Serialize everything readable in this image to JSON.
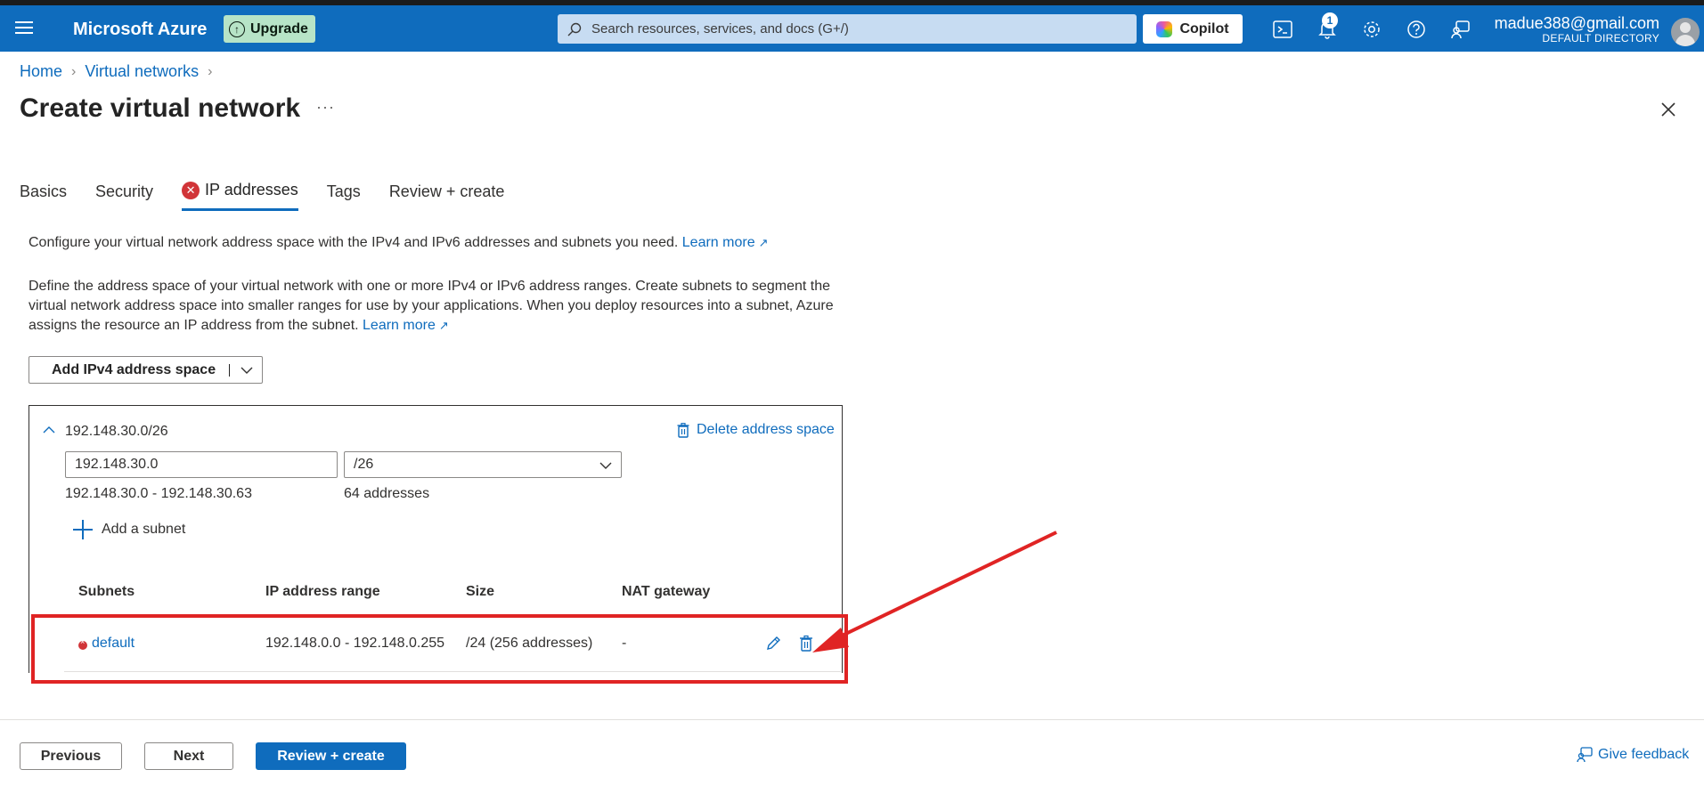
{
  "topbar": {
    "brand": "Microsoft Azure",
    "upgrade_label": "Upgrade",
    "search_placeholder": "Search resources, services, and docs (G+/)",
    "copilot_label": "Copilot",
    "notification_count": "1",
    "user_email": "madue388@gmail.com",
    "user_directory": "DEFAULT DIRECTORY"
  },
  "breadcrumb": {
    "items": [
      "Home",
      "Virtual networks"
    ]
  },
  "page": {
    "title": "Create virtual network",
    "more": "···"
  },
  "tabs": [
    {
      "label": "Basics"
    },
    {
      "label": "Security"
    },
    {
      "label": "IP addresses",
      "error": true,
      "active": true
    },
    {
      "label": "Tags"
    },
    {
      "label": "Review + create"
    }
  ],
  "intro": {
    "line1": "Configure your virtual network address space with the IPv4 and IPv6 addresses and subnets you need.",
    "line1_link": "Learn more",
    "line2": "Define the address space of your virtual network with one or more IPv4 or IPv6 address ranges. Create subnets to segment the virtual network address space into smaller ranges for use by your applications. When you deploy resources into a subnet, Azure assigns the resource an IP address from the subnet.",
    "line2_link": "Learn more"
  },
  "address_space": {
    "add_button": "Add IPv4 address space",
    "cidr": "192.148.30.0/26",
    "delete_label": "Delete address space",
    "start_ip": "192.148.30.0",
    "prefix": "/26",
    "range": "192.148.30.0 - 192.148.30.63",
    "count": "64 addresses",
    "add_subnet": "Add a subnet"
  },
  "subnets_table": {
    "headers": [
      "Subnets",
      "IP address range",
      "Size",
      "NAT gateway"
    ],
    "rows": [
      {
        "name": "default",
        "range": "192.148.0.0 - 192.148.0.255",
        "size": "/24 (256 addresses)",
        "nat": "-"
      }
    ]
  },
  "footer": {
    "previous": "Previous",
    "next": "Next",
    "review": "Review + create",
    "feedback": "Give feedback"
  },
  "colors": {
    "accent": "#0f6cbd",
    "error": "#d13438",
    "annotation": "#e02424"
  }
}
